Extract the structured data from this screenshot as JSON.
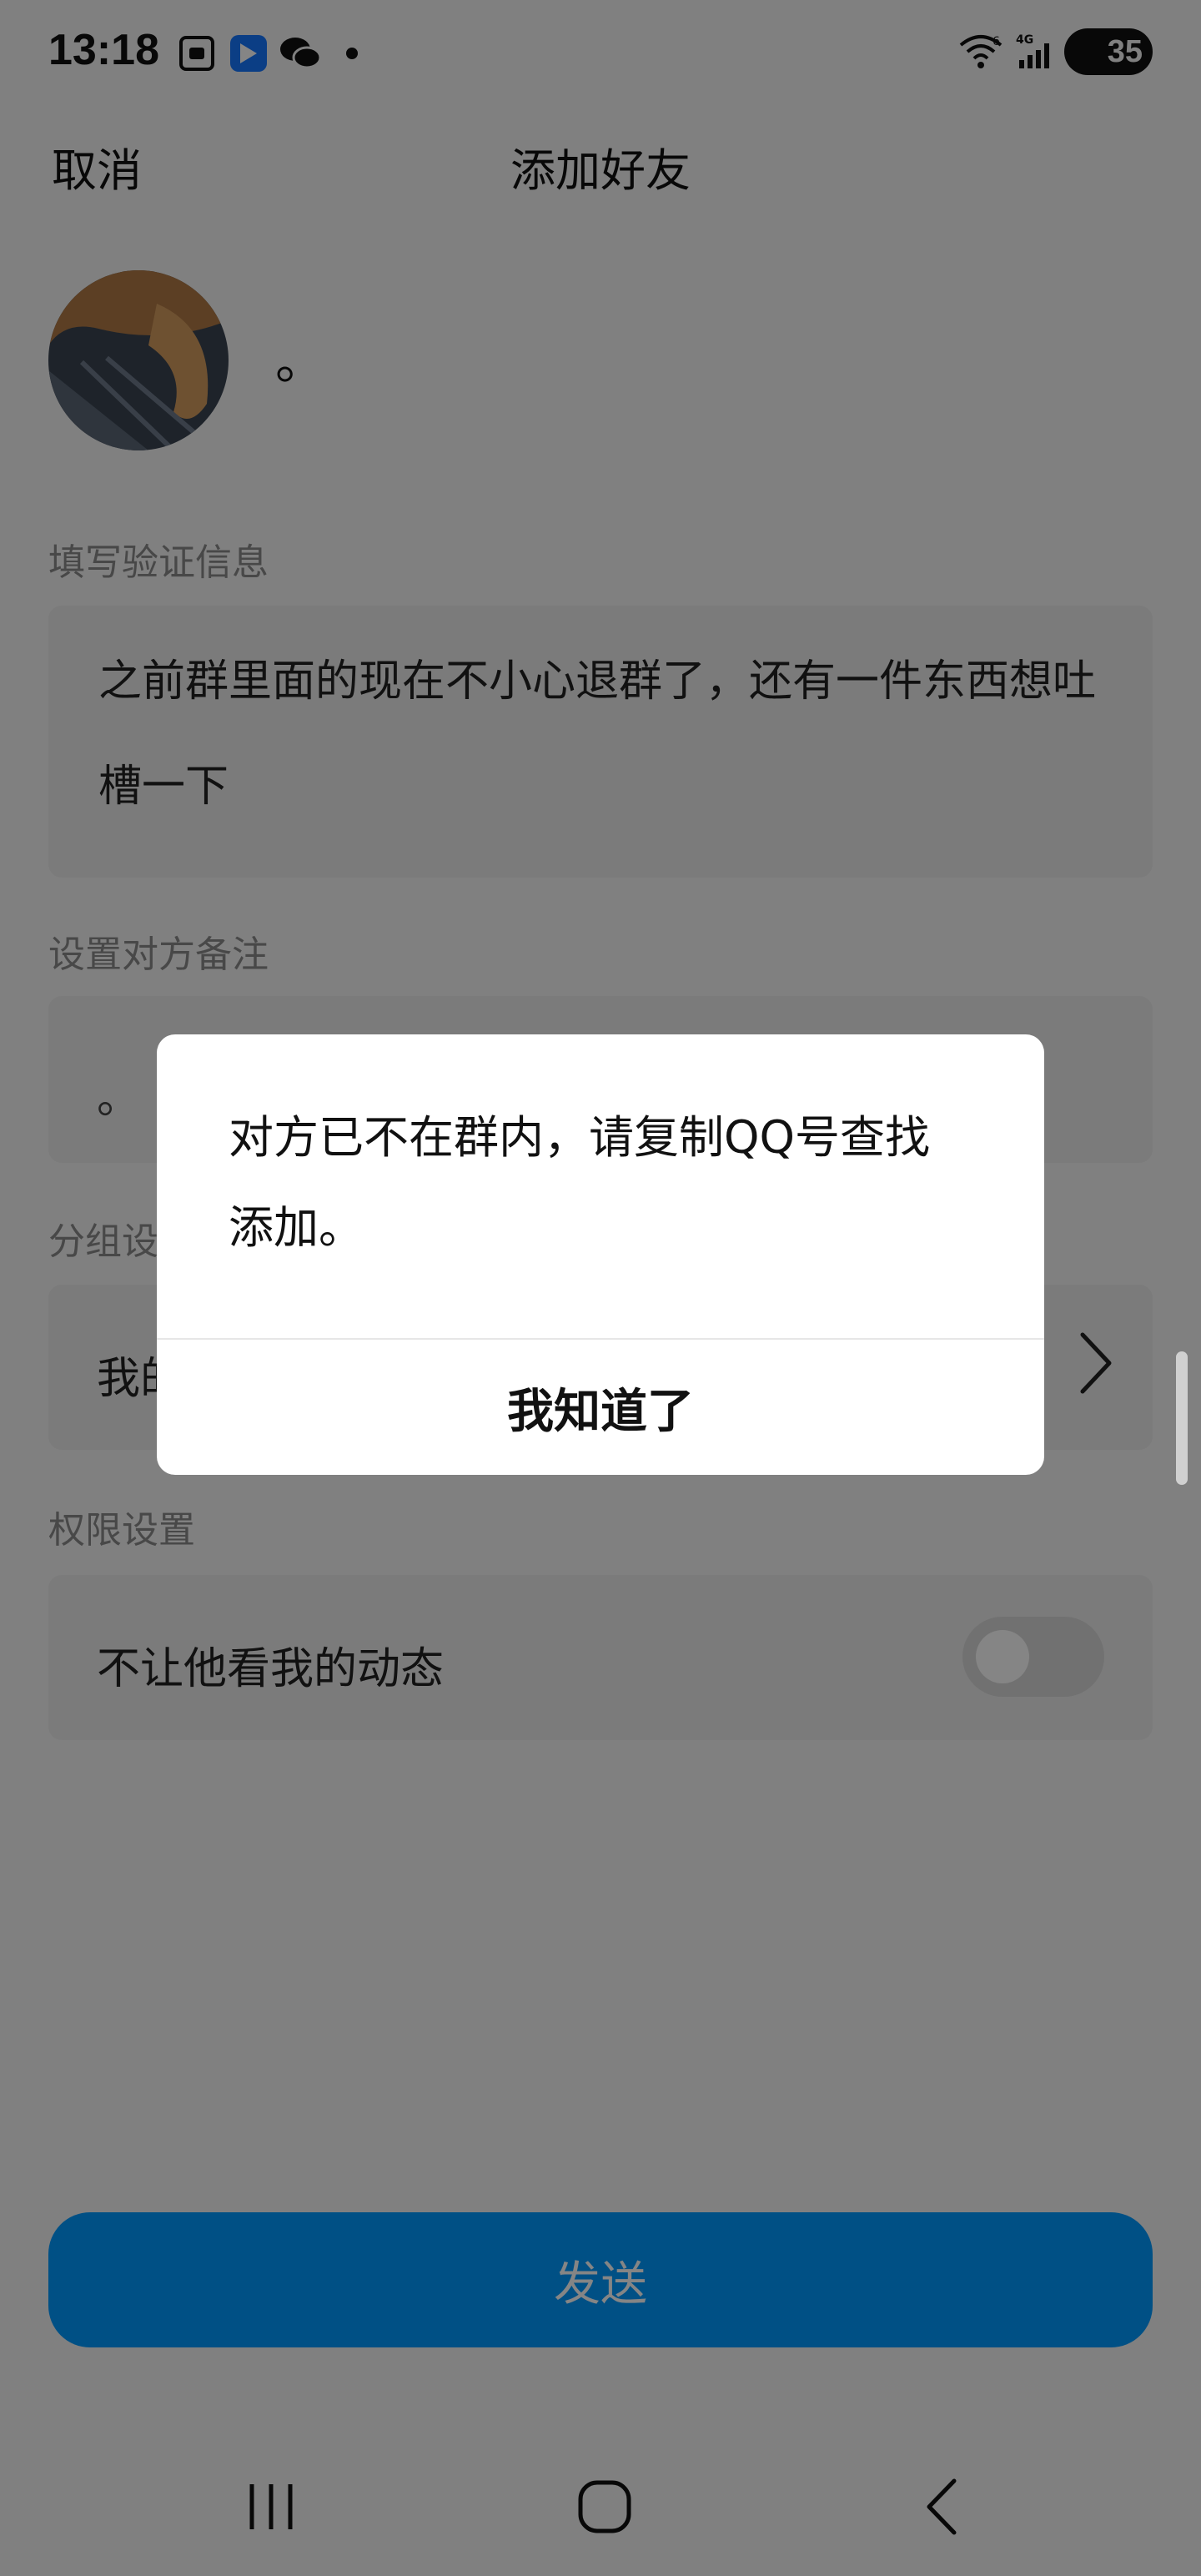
{
  "status_bar": {
    "time": "13:18",
    "icons_left": [
      "screenshot-icon",
      "feishu-icon",
      "wechat-icon",
      "dot-icon"
    ],
    "wifi_label": "6",
    "network_label": "4G",
    "battery": "35"
  },
  "header": {
    "cancel_label": "取消",
    "title": "添加好友"
  },
  "profile": {
    "nickname": "。"
  },
  "verify": {
    "label": "填写验证信息",
    "text": "之前群里面的现在不小心退群了，还有一件东西想吐槽一下"
  },
  "remark": {
    "label": "设置对方备注",
    "value": "。"
  },
  "group": {
    "label": "分组设置",
    "value": "我的好友"
  },
  "permission": {
    "label": "权限设置",
    "item_label": "不让他看我的动态",
    "toggle_on": false
  },
  "send_label": "发送",
  "dialog": {
    "message": "对方已不在群内，请复制QQ号查找添加。",
    "button_label": "我知道了"
  },
  "nav": [
    "recents-icon",
    "home-icon",
    "back-icon"
  ],
  "colors": {
    "accent": "#0099ff",
    "overlay": "rgba(0,0,0,0.48)",
    "card": "#ececec",
    "background": "#f5f5f5"
  }
}
